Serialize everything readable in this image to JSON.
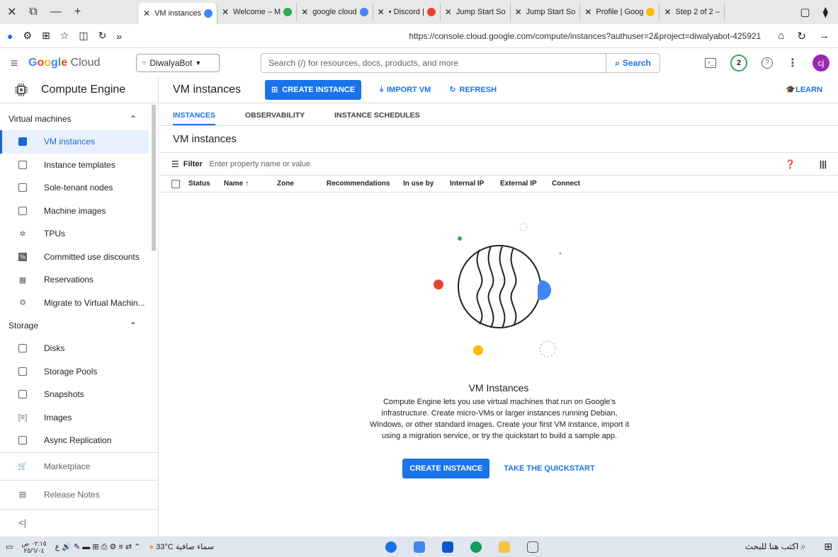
{
  "browser": {
    "tabs": [
      {
        "label": "VM instances",
        "active": true
      },
      {
        "label": "Welcome – M",
        "active": false
      },
      {
        "label": "google cloud",
        "active": false
      },
      {
        "label": "• Discord |",
        "active": false
      },
      {
        "label": "Jump Start So",
        "active": false
      },
      {
        "label": "Jump Start So",
        "active": false
      },
      {
        "label": "Profile | Goog",
        "active": false
      },
      {
        "label": "Step 2 of 2 –",
        "active": false
      }
    ],
    "url": "https://console.cloud.google.com/compute/instances?authuser=2&project=diwalyabot-425921"
  },
  "topbar": {
    "logo_google": "Google",
    "logo_cloud": " Cloud",
    "project": "DiwalyaBot",
    "search_placeholder": "Search (/) for resources, docs, products, and more",
    "search_button": "Search",
    "notifications": "2",
    "avatar": "cj"
  },
  "sidebar": {
    "product": "Compute Engine",
    "sections": [
      {
        "title": "Virtual machines",
        "items": [
          "VM instances",
          "Instance templates",
          "Sole-tenant nodes",
          "Machine images",
          "TPUs",
          "Committed use discounts",
          "Reservations",
          "Migrate to Virtual Machin..."
        ]
      },
      {
        "title": "Storage",
        "items": [
          "Disks",
          "Storage Pools",
          "Snapshots",
          "Images",
          "Async Replication"
        ]
      }
    ],
    "marketplace": "Marketplace",
    "release_notes": "Release Notes",
    "collapse": "<|"
  },
  "main": {
    "title": "VM instances",
    "create_button": "CREATE INSTANCE",
    "import_button": "IMPORT VM",
    "refresh_button": "REFRESH",
    "learn_button": "LEARN",
    "tabs": [
      "INSTANCES",
      "OBSERVABILITY",
      "INSTANCE SCHEDULES"
    ],
    "section_title": "VM instances",
    "filter_label": "Filter",
    "filter_placeholder": "Enter property name or value",
    "columns": [
      "Status",
      "Name",
      "Zone",
      "Recommendations",
      "In use by",
      "Internal IP",
      "External IP",
      "Connect"
    ],
    "empty_title": "VM Instances",
    "empty_desc": "Compute Engine lets you use virtual machines that run on Google's infrastructure. Create micro-VMs or larger instances running Debian, Windows, or other standard images. Create your first VM instance, import it using a migration service, or try the quickstart to build a sample app.",
    "empty_create": "CREATE INSTANCE",
    "empty_quickstart": "TAKE THE QUICKSTART"
  },
  "taskbar": {
    "weather": "33°C سماء صافية",
    "search": "اكتب هنا للبحث",
    "time": "٠٢:١٥ ص",
    "date": "٢٥/٦/٠٤"
  },
  "colors": {
    "accent": "#1a73e8",
    "active_bg": "#e8f0fe",
    "avatar": "#9c27b0"
  }
}
